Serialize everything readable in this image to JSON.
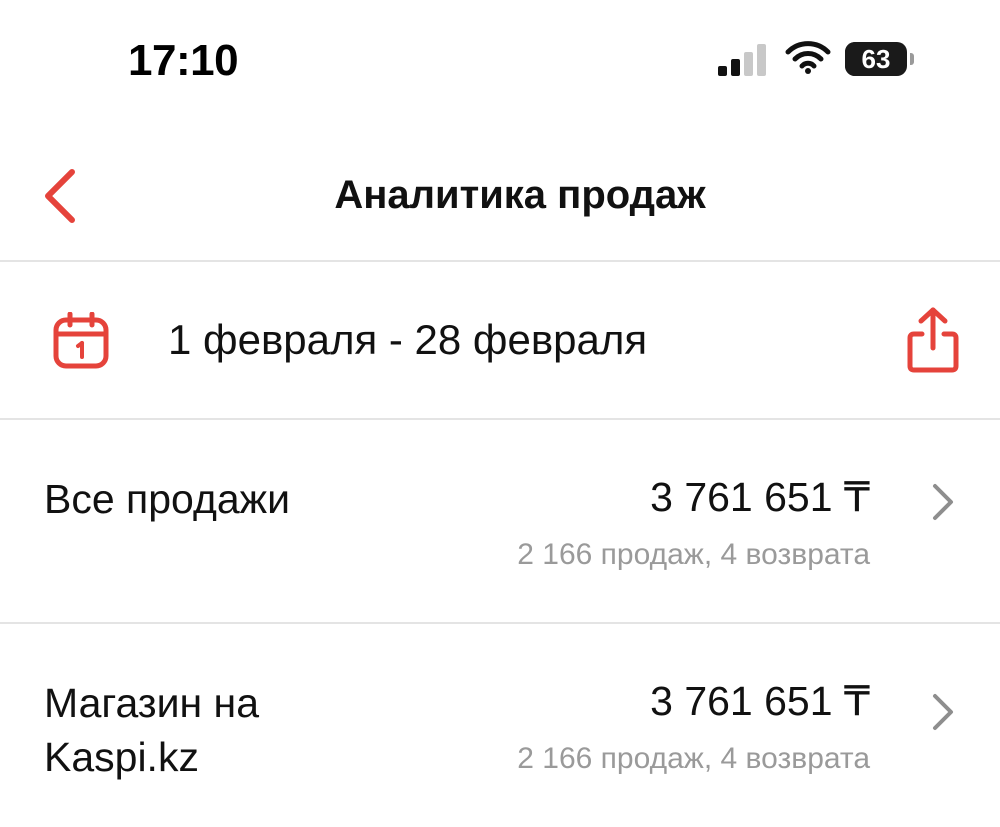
{
  "status_bar": {
    "time": "17:10",
    "battery_percent": "63",
    "battery_level": 0.63,
    "icons": [
      "signal-icon",
      "wifi-icon",
      "battery-icon"
    ]
  },
  "header": {
    "title": "Аналитика продаж",
    "back_icon": "chevron-left-icon"
  },
  "period": {
    "range": "1 февраля - 28 февраля",
    "calendar_icon": "calendar-icon",
    "share_icon": "share-icon"
  },
  "rows": [
    {
      "label": "Все продажи",
      "amount": "3 761 651 ₸",
      "details": "2 166 продаж, 4 возврата"
    },
    {
      "label": "Магазин на Kaspi.kz",
      "amount": "3 761 651 ₸",
      "details": "2 166 продаж, 4 возврата"
    }
  ],
  "colors": {
    "accent": "#e5433b",
    "text": "#111111",
    "secondary_text": "#9a9a9a",
    "divider": "#e4e4e4"
  }
}
